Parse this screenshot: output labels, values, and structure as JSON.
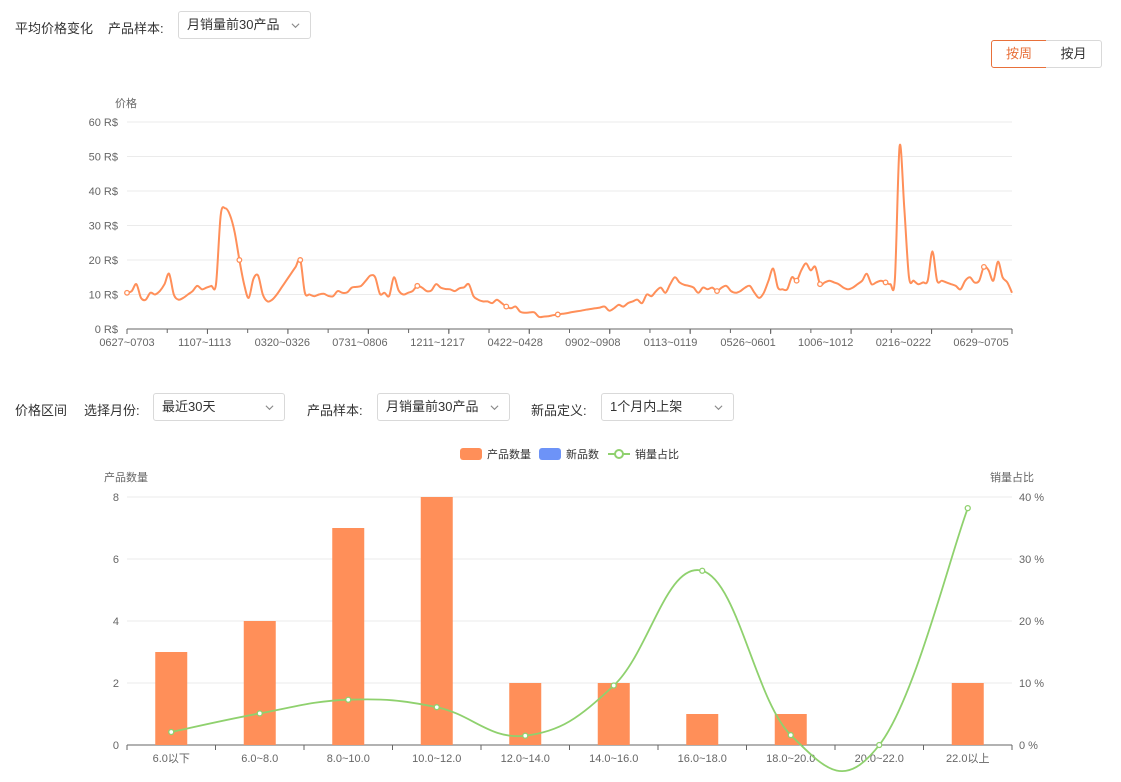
{
  "section1": {
    "title": "平均价格变化",
    "sample_label": "产品样本:",
    "sample_value": "月销量前30产品",
    "toggle": [
      "按周",
      "按月"
    ],
    "active_toggle": 0
  },
  "section2": {
    "title": "价格区间",
    "month_label": "选择月份:",
    "month_value": "最近30天",
    "sample_label": "产品样本:",
    "sample_value": "月销量前30产品",
    "newdef_label": "新品定义:",
    "newdef_value": "1个月内上架"
  },
  "colors": {
    "accent": "#e8703a",
    "orange": "#ff8f59",
    "blue": "#6d93f7",
    "green": "#8fd16e"
  },
  "chart_data": [
    {
      "type": "line",
      "ylabel": "价格",
      "ylim": [
        0,
        60
      ],
      "y_ticks": [
        "0 R$",
        "10 R$",
        "20 R$",
        "30 R$",
        "40 R$",
        "50 R$",
        "60 R$"
      ],
      "x_ticks": [
        "0627~0703",
        "1107~1113",
        "0320~0326",
        "0731~0806",
        "1211~1217",
        "0422~0428",
        "0902~0908",
        "0113~0119",
        "0526~0601",
        "1006~1012",
        "0216~0222",
        "0629~0705"
      ],
      "grid": true,
      "values": [
        10.5,
        11,
        13,
        9,
        8.5,
        10.5,
        10,
        11,
        13,
        16,
        10,
        8.5,
        9,
        10,
        11,
        12.5,
        11.5,
        12,
        12.5,
        13,
        33,
        35,
        33,
        28,
        20,
        13,
        9,
        14.5,
        15.5,
        10,
        8,
        8.5,
        10,
        12,
        14,
        16,
        18,
        20,
        10.5,
        10,
        9.5,
        10,
        10.2,
        9.6,
        9.5,
        11,
        10.5,
        10.6,
        12,
        12.2,
        12.5,
        14,
        15.5,
        15,
        10.2,
        10.5,
        9.6,
        15,
        11.2,
        10,
        10.5,
        11,
        12.5,
        12,
        11,
        11.2,
        13,
        12,
        11.6,
        11.5,
        11,
        11.8,
        12.1,
        13,
        9.5,
        8.5,
        8,
        8,
        7.5,
        8.5,
        7.5,
        6.5,
        6,
        6.5,
        5,
        4.7,
        4.8,
        4.8,
        3.5,
        3.6,
        3.7,
        4,
        4.2,
        4.4,
        4.6,
        4.9,
        5.1,
        5.3,
        5.6,
        5.8,
        6,
        6.2,
        6.5,
        5.3,
        6,
        7,
        6.5,
        7.5,
        8,
        8.5,
        7.5,
        10,
        9.5,
        11,
        12,
        10.5,
        13,
        15,
        13.5,
        12.8,
        12.5,
        12,
        10.5,
        12,
        11.5,
        12,
        11,
        12,
        12.5,
        11,
        10.5,
        11,
        12,
        12.5,
        10.5,
        9,
        10.5,
        14,
        17.5,
        12,
        11.5,
        11.5,
        15,
        14,
        17,
        19,
        17,
        18,
        13,
        13.5,
        14,
        13.5,
        13,
        12,
        11.5,
        12,
        13,
        14,
        16,
        13,
        13.5,
        14,
        13.5,
        13,
        14.5,
        53,
        35,
        15,
        14,
        13,
        13.5,
        14,
        22.5,
        14,
        14,
        13.5,
        13,
        12.5,
        11.5,
        14,
        15,
        13.5,
        14,
        18,
        17,
        14,
        19.5,
        15,
        13.5,
        10.5
      ],
      "markers": [
        0,
        24,
        37,
        62,
        81,
        92,
        126,
        143,
        148,
        162,
        183
      ]
    },
    {
      "type": "bar",
      "legend": [
        "产品数量",
        "新品数",
        "销量占比"
      ],
      "legend_position": "top-center",
      "ylabel_left": "产品数量",
      "ylabel_right": "销量占比",
      "ylim_left": [
        0,
        8
      ],
      "ylim_right": [
        0,
        40
      ],
      "y_ticks_left": [
        "0",
        "2",
        "4",
        "6",
        "8"
      ],
      "y_ticks_right": [
        "0 %",
        "10 %",
        "20 %",
        "30 %",
        "40 %"
      ],
      "categories": [
        "6.0以下",
        "6.0~8.0",
        "8.0~10.0",
        "10.0~12.0",
        "12.0~14.0",
        "14.0~16.0",
        "16.0~18.0",
        "18.0~20.0",
        "20.0~22.0",
        "22.0以上"
      ],
      "series": [
        {
          "name": "产品数量",
          "values": [
            3,
            4,
            7,
            8,
            2,
            2,
            1,
            1,
            0,
            2
          ]
        },
        {
          "name": "新品数",
          "values": [
            0,
            0,
            0,
            0,
            0,
            0,
            0,
            0,
            0,
            0
          ]
        },
        {
          "name": "销量占比",
          "values": [
            2.1,
            5.1,
            7.3,
            6.1,
            1.5,
            9.6,
            28.1,
            1.6,
            0,
            38.2
          ]
        }
      ]
    }
  ]
}
